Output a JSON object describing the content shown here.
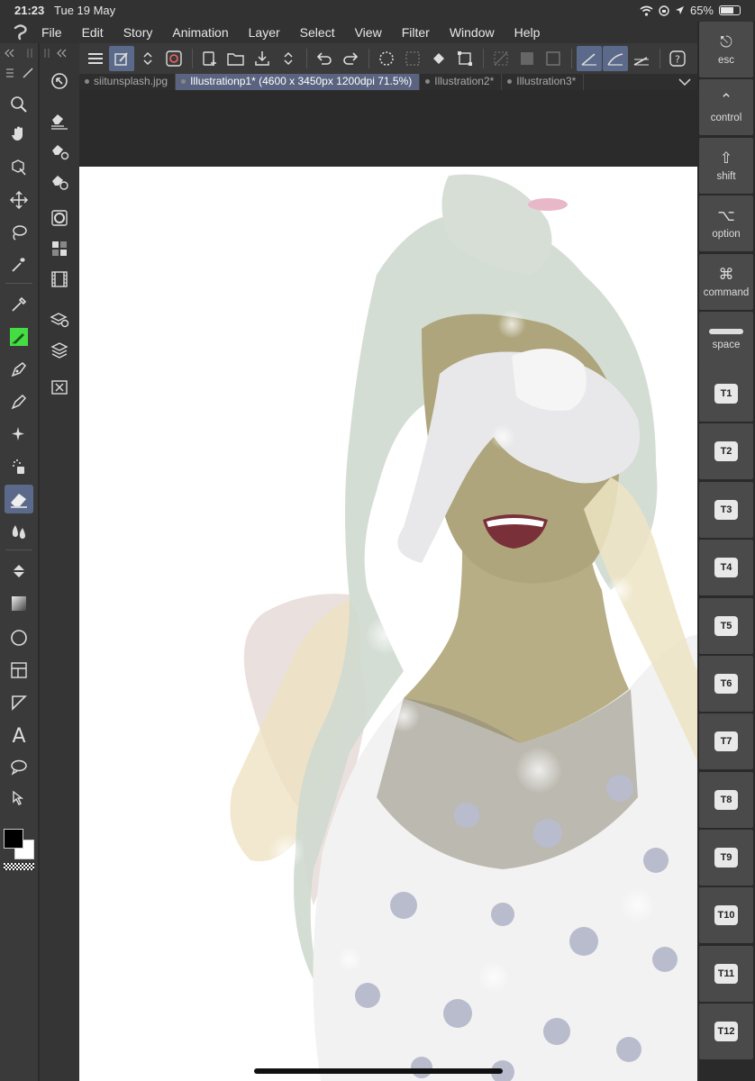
{
  "status": {
    "time": "21:23",
    "date": "Tue 19 May",
    "battery": "65%",
    "battery_level": 0.65
  },
  "menu": [
    "File",
    "Edit",
    "Story",
    "Animation",
    "Layer",
    "Select",
    "View",
    "Filter",
    "Window",
    "Help"
  ],
  "tabs": [
    {
      "label": "siitunsplash.jpg",
      "active": false
    },
    {
      "label": "Illustrationp1* (4600 x 3450px 1200dpi 71.5%)",
      "active": true
    },
    {
      "label": "Illustration2*",
      "active": false
    },
    {
      "label": "Illustration3*",
      "active": false
    }
  ],
  "modifiers": [
    {
      "glyph": "⎋",
      "label": "esc"
    },
    {
      "glyph": "⌃",
      "label": "control"
    },
    {
      "glyph": "⇧",
      "label": "shift"
    },
    {
      "glyph": "⌥",
      "label": "option"
    },
    {
      "glyph": "⌘",
      "label": "command"
    },
    {
      "glyph": "▬",
      "label": "space"
    }
  ],
  "touch_keys": [
    "T1",
    "T2",
    "T3",
    "T4",
    "T5",
    "T6",
    "T7",
    "T8",
    "T9",
    "T10",
    "T11",
    "T12"
  ],
  "colors": {
    "accent": "#5b6a8a",
    "active_tab": "#5a6480",
    "main_color": "#000000",
    "sub_color": "#ffffff",
    "tool_highlight": "#44dd44"
  }
}
